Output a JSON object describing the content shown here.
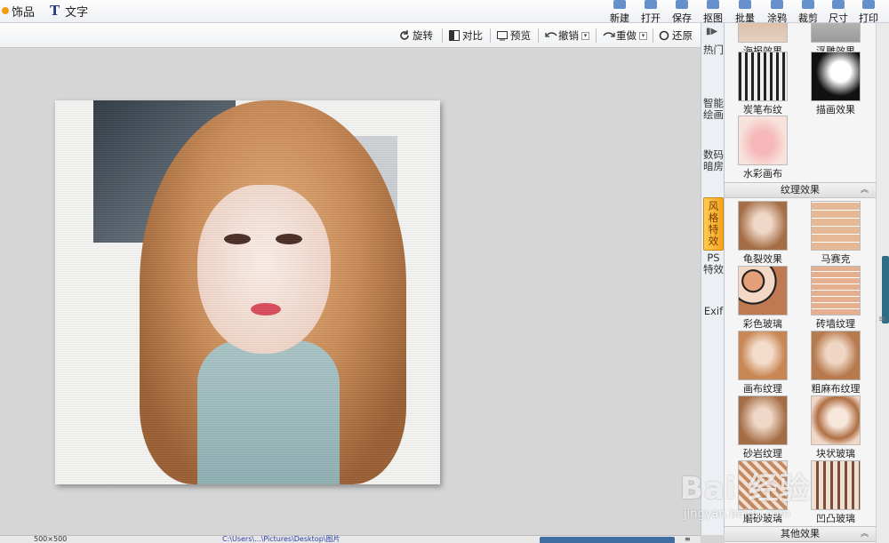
{
  "top_tabs": [
    {
      "label": "饰品",
      "icon": "ornament-icon"
    },
    {
      "label": "文字",
      "icon": "text-icon"
    }
  ],
  "toolbar": [
    {
      "label": "新建",
      "icon": "new-file-icon"
    },
    {
      "label": "打开",
      "icon": "open-folder-icon"
    },
    {
      "label": "保存",
      "icon": "save-icon"
    },
    {
      "label": "抠图",
      "icon": "cutout-icon"
    },
    {
      "label": "批量",
      "icon": "batch-icon"
    },
    {
      "label": "涂鸦",
      "icon": "doodle-icon"
    },
    {
      "label": "裁剪",
      "icon": "crop-icon"
    },
    {
      "label": "尺寸",
      "icon": "resize-icon"
    },
    {
      "label": "打印",
      "icon": "print-icon"
    }
  ],
  "edit_toolbar": {
    "rotate": "旋转",
    "compare": "对比",
    "preview": "预览",
    "undo": "撤销",
    "redo": "重做",
    "restore": "还原"
  },
  "category_tabs": [
    {
      "label": "热门",
      "active": false
    },
    {
      "label": "智能绘画",
      "active": false
    },
    {
      "label": "数码暗房",
      "active": false
    },
    {
      "label": "风格特效",
      "active": true
    },
    {
      "label": "PS特效",
      "active": false
    },
    {
      "label": "Exif",
      "active": false
    }
  ],
  "effects_top": [
    {
      "label": "海报效果",
      "thumb": "t-poster"
    },
    {
      "label": "浮雕效果",
      "thumb": "t-carve"
    },
    {
      "label": "炭笔布纹",
      "thumb": "t-char"
    },
    {
      "label": "描画效果",
      "thumb": "t-line"
    },
    {
      "label": "水彩画布",
      "thumb": "t-water"
    }
  ],
  "section_texture": "纹理效果",
  "effects_texture": [
    {
      "label": "龟裂效果",
      "thumb": "t-crack"
    },
    {
      "label": "马赛克",
      "thumb": "t-mosaic"
    },
    {
      "label": "彩色玻璃",
      "thumb": "t-stained"
    },
    {
      "label": "砖墙纹理",
      "thumb": "t-brick"
    },
    {
      "label": "画布纹理",
      "thumb": "t-canvas"
    },
    {
      "label": "粗麻布纹理",
      "thumb": "t-linen"
    },
    {
      "label": "砂岩纹理",
      "thumb": "t-crack"
    },
    {
      "label": "块状玻璃",
      "thumb": "t-block"
    },
    {
      "label": "磨砂玻璃",
      "thumb": "t-frost"
    },
    {
      "label": "凹凸玻璃",
      "thumb": "t-emboss"
    }
  ],
  "section_other": "其他效果",
  "status": {
    "dimensions": "500×500",
    "path": "C:\\Users\\...\\Pictures\\Desktop\\图片"
  },
  "watermark": {
    "logo": "Bai 经验",
    "url": "jingyan.baidu.com"
  }
}
